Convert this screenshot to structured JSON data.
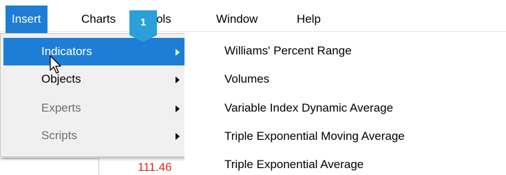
{
  "menubar": {
    "items": [
      {
        "label": "Insert"
      },
      {
        "label": "Charts"
      },
      {
        "label": "Tools"
      },
      {
        "label": "Window"
      },
      {
        "label": "Help"
      }
    ]
  },
  "dropdown": {
    "items": [
      {
        "label": "Indicators"
      },
      {
        "label": "Objects"
      },
      {
        "label": "Experts"
      },
      {
        "label": "Scripts"
      }
    ]
  },
  "submenu": {
    "items": [
      {
        "label": "Williams' Percent Range"
      },
      {
        "label": "Volumes"
      },
      {
        "label": "Variable Index Dynamic Average"
      },
      {
        "label": "Triple Exponential Moving Average"
      },
      {
        "label": "Triple Exponential Average"
      }
    ]
  },
  "badge": {
    "label": "1"
  },
  "chart": {
    "price_label": "111.46"
  },
  "colors": {
    "accent": "#1e7ed6",
    "badge": "#2a9fd8",
    "price": "#e0281c"
  }
}
